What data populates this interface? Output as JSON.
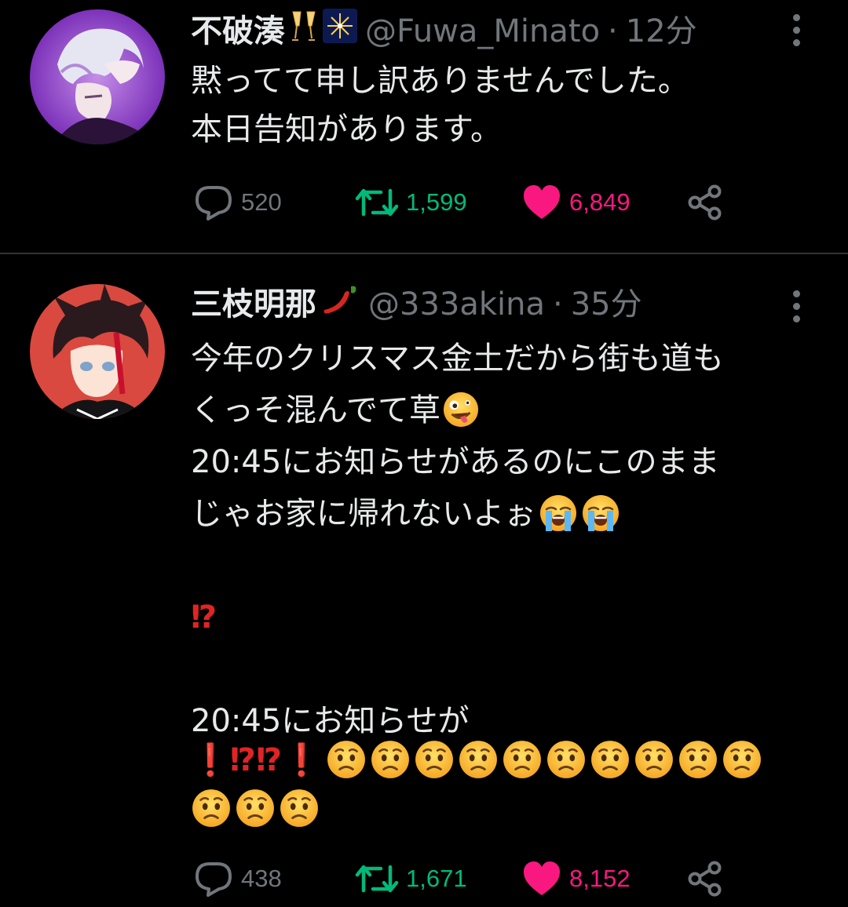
{
  "colors": {
    "background": "#000000",
    "text": "#e7e9ea",
    "muted": "#71767b",
    "retweet": "#00ba7c",
    "like": "#f91880",
    "divider": "#2f3336"
  },
  "tweets": [
    {
      "name": "不破湊",
      "name_emojis": [
        "champagne-glasses-emoji",
        "fireworks-emoji"
      ],
      "handle": "@Fuwa_Minato",
      "separator": "·",
      "time": "12分",
      "text_lines": [
        "黙ってて申し訳ありませんでした。",
        "本日告知があります。"
      ],
      "stats": {
        "replies": "520",
        "retweets": "1,599",
        "likes": "6,849",
        "liked": true,
        "retweeted": true
      }
    },
    {
      "name": "三枝明那",
      "name_emojis": [
        "hot-pepper-emoji"
      ],
      "handle": "@333akina",
      "separator": "·",
      "time": "35分",
      "text_lines": [
        "今年のクリスマス金土だから街も道も",
        "くっそ混んでて草",
        "20:45にお知らせがあるのにこのまま",
        "じゃお家に帰れないよぉ",
        "",
        "⁉",
        "",
        "20:45にお知らせが",
        "❗⁉⁉❗",
        ""
      ],
      "line_emojis": {
        "line2": "zany-face-emoji",
        "line4": [
          "loudly-crying-face-emoji",
          "loudly-crying-face-emoji"
        ],
        "worried_faces_count": 13
      },
      "stats": {
        "replies": "438",
        "retweets": "1,671",
        "likes": "8,152",
        "liked": true,
        "retweeted": true
      }
    }
  ]
}
